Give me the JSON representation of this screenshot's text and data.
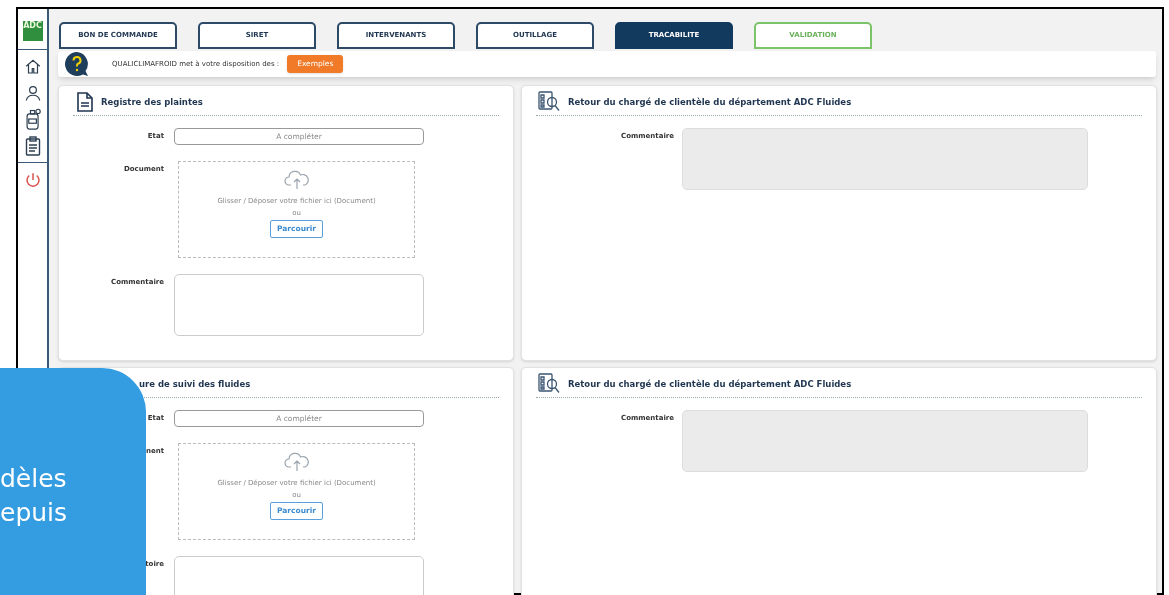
{
  "sidebar": {
    "logo": "ADC"
  },
  "tabs": [
    {
      "label": "BON DE COMMANDE",
      "selected": false,
      "kind": "step"
    },
    {
      "label": "SIRET",
      "selected": false,
      "kind": "step"
    },
    {
      "label": "INTERVENANTS",
      "selected": false,
      "kind": "step"
    },
    {
      "label": "OUTILLAGE",
      "selected": false,
      "kind": "step"
    },
    {
      "label": "TRACABILITE",
      "selected": true,
      "kind": "step"
    },
    {
      "label": "VALIDATION",
      "selected": false,
      "kind": "validation"
    }
  ],
  "info_bar": {
    "text": "QUALICLIMAFROID met à votre disposition des :",
    "button": "Exemples"
  },
  "sections": [
    {
      "left": {
        "kind": "document",
        "title": "Registre des plaintes",
        "fields": [
          {
            "kind": "select",
            "label": "Etat",
            "placeholder": "A compléter"
          },
          {
            "kind": "upload",
            "label": "Document",
            "hint": "Glisser / Déposer votre fichier ici (Document)",
            "or": "ou",
            "button": "Parcourir"
          },
          {
            "kind": "textarea",
            "label": "Commentaire",
            "disabled": false
          }
        ]
      },
      "right": {
        "title": "Retour du chargé de clientèle du département ADC Fluides",
        "fields": [
          {
            "kind": "textarea",
            "label": "Commentaire",
            "disabled": true
          }
        ]
      }
    },
    {
      "left": {
        "kind": "partial",
        "title": "ure de suivi des fluides",
        "fields": [
          {
            "kind": "select",
            "label": "Etat",
            "placeholder": "A compléter"
          },
          {
            "kind": "upload",
            "label": "nent",
            "hint": "Glisser / Déposer votre fichier ici (Document)",
            "or": "ou",
            "button": "Parcourir"
          },
          {
            "kind": "textarea",
            "label": "toire",
            "disabled": false
          }
        ]
      },
      "right": {
        "title": "Retour du chargé de clientèle du département ADC Fluides",
        "fields": [
          {
            "kind": "textarea",
            "label": "Commentaire",
            "disabled": true
          }
        ]
      }
    }
  ],
  "overlay": {
    "lines": [
      "dèles",
      "epuis"
    ]
  }
}
